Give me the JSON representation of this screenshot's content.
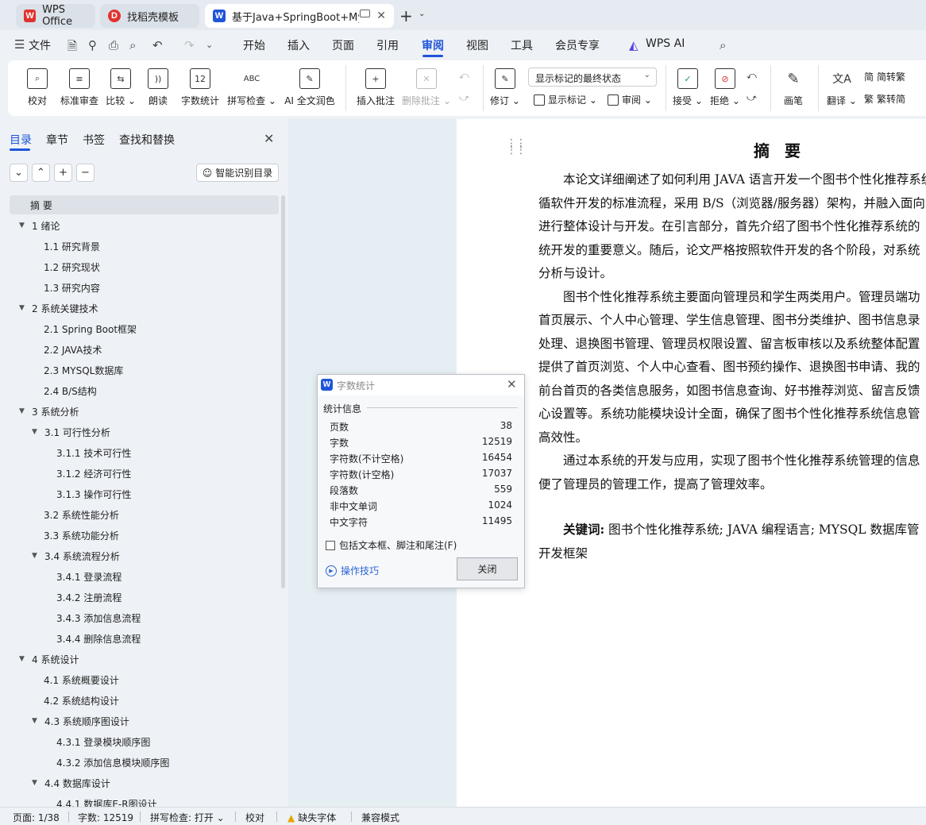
{
  "tabs": [
    {
      "label": "WPS Office",
      "logo": "W",
      "logo_color": "#e0322f"
    },
    {
      "label": "找稻壳模板",
      "logo": "D",
      "logo_color": "#e0322f"
    },
    {
      "label": "基于Java+SpringBoot+MyS",
      "logo": "W",
      "logo_color": "#1f55d8"
    }
  ],
  "menu": {
    "file": "文件",
    "items": [
      "开始",
      "插入",
      "页面",
      "引用",
      "审阅",
      "视图",
      "工具",
      "会员专享"
    ],
    "active": "审阅",
    "ai": "WPS AI"
  },
  "ribbon": {
    "proofread": "校对",
    "standard_review": "标准审查",
    "compare": "比较",
    "read_aloud": "朗读",
    "word_count": "字数统计",
    "spell_check": "拼写检查",
    "ai_polish": "AI 全文润色",
    "insert_comment": "插入批注",
    "delete_comment": "删除批注",
    "revise": "修订",
    "markup_select": "显示标记的最终状态",
    "show_markup": "显示标记",
    "review": "审阅",
    "accept": "接受",
    "reject": "拒绝",
    "pen": "画笔",
    "translate": "翻译",
    "to_traditional": "简转繁",
    "to_simplified": "繁转简"
  },
  "nav": {
    "tabs": [
      "目录",
      "章节",
      "书签",
      "查找和替换"
    ],
    "smart_toc": "智能识别目录",
    "toc": [
      {
        "label": "摘  要",
        "level": 0,
        "arrow": ""
      },
      {
        "label": "1  绪论",
        "level": 0,
        "arrow": "▼"
      },
      {
        "label": "1.1 研究背景",
        "level": 1,
        "arrow": ""
      },
      {
        "label": "1.2 研究现状",
        "level": 1,
        "arrow": ""
      },
      {
        "label": "1.3 研究内容",
        "level": 1,
        "arrow": ""
      },
      {
        "label": "2  系统关键技术",
        "level": 0,
        "arrow": "▼"
      },
      {
        "label": "2.1 Spring    Boot框架",
        "level": 1,
        "arrow": ""
      },
      {
        "label": "2.2 JAVA技术",
        "level": 1,
        "arrow": ""
      },
      {
        "label": "2.3 MYSQL数据库",
        "level": 1,
        "arrow": ""
      },
      {
        "label": "2.4 B/S结构",
        "level": 1,
        "arrow": ""
      },
      {
        "label": "3  系统分析",
        "level": 0,
        "arrow": "▼"
      },
      {
        "label": "3.1  可行性分析",
        "level": 1,
        "arrow": "▼"
      },
      {
        "label": "3.1.1  技术可行性",
        "level": 2,
        "arrow": ""
      },
      {
        "label": "3.1.2 经济可行性",
        "level": 2,
        "arrow": ""
      },
      {
        "label": "3.1.3 操作可行性",
        "level": 2,
        "arrow": ""
      },
      {
        "label": "3.2  系统性能分析",
        "level": 1,
        "arrow": ""
      },
      {
        "label": "3.3  系统功能分析",
        "level": 1,
        "arrow": ""
      },
      {
        "label": "3.4 系统流程分析",
        "level": 1,
        "arrow": "▼"
      },
      {
        "label": "3.4.1 登录流程",
        "level": 2,
        "arrow": ""
      },
      {
        "label": "3.4.2 注册流程",
        "level": 2,
        "arrow": ""
      },
      {
        "label": "3.4.3 添加信息流程",
        "level": 2,
        "arrow": ""
      },
      {
        "label": "3.4.4 删除信息流程",
        "level": 2,
        "arrow": ""
      },
      {
        "label": "4    系统设计",
        "level": 0,
        "arrow": "▼"
      },
      {
        "label": "4.1 系统概要设计",
        "level": 1,
        "arrow": ""
      },
      {
        "label": "4.2 系统结构设计",
        "level": 1,
        "arrow": ""
      },
      {
        "label": "4.3 系统顺序图设计",
        "level": 1,
        "arrow": "▼"
      },
      {
        "label": "4.3.1 登录模块顺序图",
        "level": 2,
        "arrow": ""
      },
      {
        "label": "4.3.2 添加信息模块顺序图",
        "level": 2,
        "arrow": ""
      },
      {
        "label": "4.4 数据库设计",
        "level": 1,
        "arrow": "▼"
      },
      {
        "label": "4.4.1 数据库E-R图设计",
        "level": 2,
        "arrow": ""
      }
    ]
  },
  "document": {
    "title": "摘  要",
    "lines": [
      "　　本论文详细阐述了如何利用 JAVA 语言开发一个图书个性化推荐系统",
      "循软件开发的标准流程，采用 B/S（浏览器/服务器）架构，并融入面向",
      "进行整体设计与开发。在引言部分，首先介绍了图书个性化推荐系统的",
      "统开发的重要意义。随后，论文严格按照软件开发的各个阶段，对系统",
      "分析与设计。",
      "　　图书个性化推荐系统主要面向管理员和学生两类用户。管理员端功",
      "首页展示、个人中心管理、学生信息管理、图书分类维护、图书信息录",
      "处理、退换图书管理、管理员权限设置、留言板审核以及系统整体配置",
      "提供了首页浏览、个人中心查看、图书预约操作、退换图书申请、我的",
      "前台首页的各类信息服务，如图书信息查询、好书推荐浏览、留言反馈",
      "心设置等。系统功能模块设计全面，确保了图书个性化推荐系统信息管",
      "高效性。",
      "　　通过本系统的开发与应用，实现了图书个性化推荐系统管理的信息",
      "便了管理员的管理工作，提高了管理效率。"
    ],
    "keywords_label": "关键词:",
    "keywords_text": " 图书个性化推荐系统; JAVA 编程语言; MYSQL 数据库管",
    "keywords_line2": "开发框架"
  },
  "dialog": {
    "title": "字数统计",
    "group": "统计信息",
    "rows": [
      {
        "label": "页数",
        "value": "38"
      },
      {
        "label": "字数",
        "value": "12519"
      },
      {
        "label": "字符数(不计空格)",
        "value": "16454"
      },
      {
        "label": "字符数(计空格)",
        "value": "17037"
      },
      {
        "label": "段落数",
        "value": "559"
      },
      {
        "label": "非中文单词",
        "value": "1024"
      },
      {
        "label": "中文字符",
        "value": "11495"
      }
    ],
    "checkbox": "包括文本框、脚注和尾注(F)",
    "tips": "操作技巧",
    "close": "关闭"
  },
  "status": {
    "page": "页面: 1/38",
    "words": "字数: 12519",
    "spell": "拼写检查: 打开",
    "proof": "校对",
    "missing_font": "缺失字体",
    "compat": "兼容模式"
  }
}
